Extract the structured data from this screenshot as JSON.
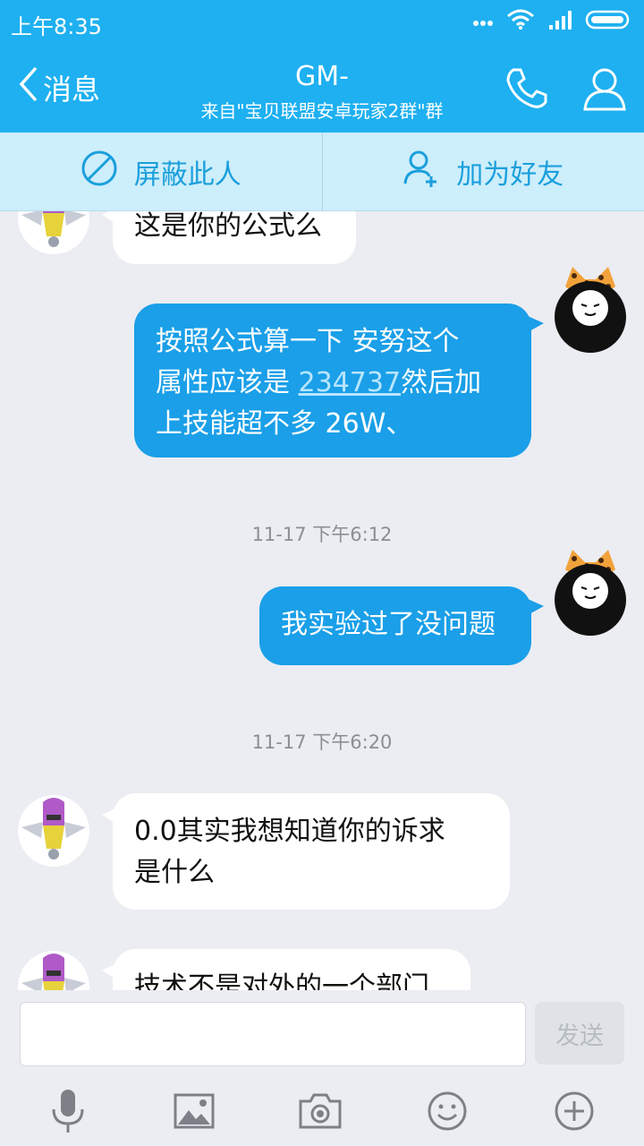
{
  "status": {
    "time": "上午8:35"
  },
  "header": {
    "back_label": "消息",
    "title": "GM-",
    "subtitle": "来自\"宝贝联盟安卓玩家2群\"群"
  },
  "actions": {
    "block_label": "屏蔽此人",
    "add_friend_label": "加为好友"
  },
  "messages": [
    {
      "side": "left",
      "lines": [
        "这是你的公式么"
      ]
    },
    {
      "side": "right",
      "line1": "按照公式算一下  安努这个",
      "line2_prefix": "属性应该是 ",
      "line2_link": "234737",
      "line2_suffix": "然后加",
      "line3": "上技能超不多 26W、"
    },
    {
      "time": "11-17 下午6:12"
    },
    {
      "side": "right",
      "lines": [
        "我实验过了没问题"
      ]
    },
    {
      "time": "11-17 下午6:20"
    },
    {
      "side": "left",
      "lines": [
        "0.0其实我想知道你的诉求",
        "是什么"
      ]
    },
    {
      "side": "left",
      "lines": [
        "技术不是对外的一个部门"
      ]
    }
  ],
  "input": {
    "placeholder": "",
    "send_label": "发送"
  },
  "toolbar": [
    "voice-icon",
    "image-icon",
    "camera-icon",
    "emoji-icon",
    "plus-icon"
  ],
  "colors": {
    "primary": "#1eb0f0",
    "bubble_self": "#1a9fe8",
    "background": "#ebedf2"
  }
}
